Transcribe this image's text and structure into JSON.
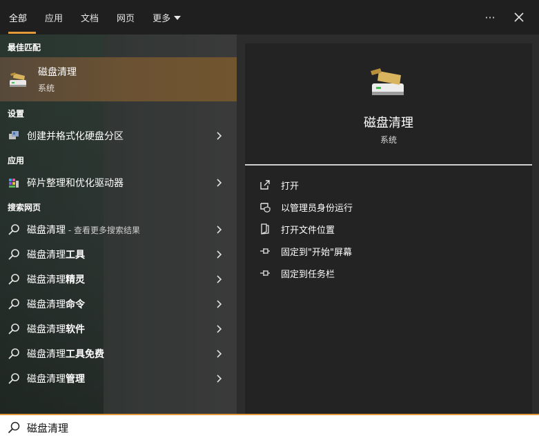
{
  "tabs": [
    {
      "label": "全部",
      "active": true
    },
    {
      "label": "应用"
    },
    {
      "label": "文档"
    },
    {
      "label": "网页"
    },
    {
      "label": "更多"
    }
  ],
  "top_actions": {
    "more": "···",
    "close": "✕"
  },
  "sections": {
    "best_match": "最佳匹配",
    "settings": "设置",
    "apps": "应用",
    "web": "搜索网页"
  },
  "best_match": {
    "title": "磁盘清理",
    "subtitle": "系统"
  },
  "settings_items": [
    {
      "label": "创建并格式化硬盘分区"
    }
  ],
  "app_items": [
    {
      "label": "碎片整理和优化驱动器"
    }
  ],
  "web_items": [
    {
      "prefix": "磁盘清理",
      "suffix": " - 查看更多搜索结果"
    },
    {
      "prefix": "磁盘清理",
      "bold": "工具"
    },
    {
      "prefix": "磁盘清理",
      "bold": "精灵"
    },
    {
      "prefix": "磁盘清理",
      "bold": "命令"
    },
    {
      "prefix": "磁盘清理",
      "bold": "软件"
    },
    {
      "prefix": "磁盘清理",
      "bold": "工具免费"
    },
    {
      "prefix": "磁盘清理",
      "bold": "管理"
    }
  ],
  "detail": {
    "title": "磁盘清理",
    "subtitle": "系统",
    "actions": [
      {
        "label": "打开",
        "icon": "open-icon"
      },
      {
        "label": "以管理员身份运行",
        "icon": "shield-icon"
      },
      {
        "label": "打开文件位置",
        "icon": "file-location-icon"
      },
      {
        "label": "固定到\"开始\"屏幕",
        "icon": "pin-icon"
      },
      {
        "label": "固定到任务栏",
        "icon": "pin-icon"
      }
    ]
  },
  "search": {
    "value": "磁盘清理"
  },
  "colors": {
    "accent": "#e39a3a",
    "highlight": "#6b5232"
  }
}
